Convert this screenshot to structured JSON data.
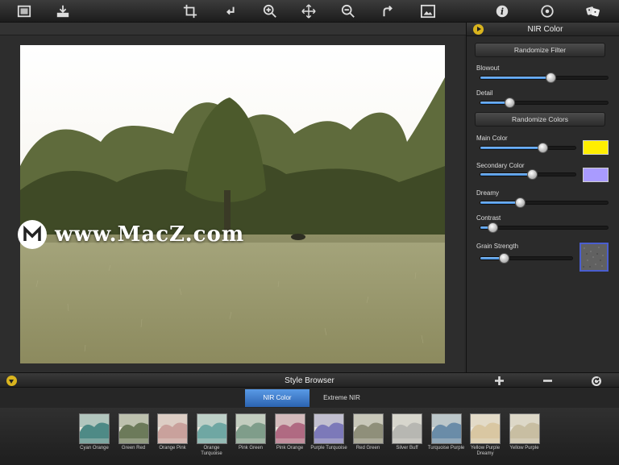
{
  "toolbar": {
    "icons": [
      "photo-icon",
      "save-icon",
      "crop-icon",
      "rotate-left-icon",
      "zoom-in-icon",
      "move-icon",
      "zoom-out-icon",
      "redo-icon",
      "fit-image-icon",
      "info-icon",
      "settings-icon",
      "dice-icon"
    ]
  },
  "watermark": {
    "text": "www.MacZ.com"
  },
  "panel": {
    "title": "NIR Color",
    "randomize_filter_label": "Randomize Filter",
    "randomize_colors_label": "Randomize Colors",
    "sliders": [
      {
        "label": "Blowout",
        "value": 0.55
      },
      {
        "label": "Detail",
        "value": 0.23
      },
      {
        "label": "Main Color",
        "value": 0.65
      },
      {
        "label": "Secondary Color",
        "value": 0.54
      },
      {
        "label": "Dreamy",
        "value": 0.31
      },
      {
        "label": "Contrast",
        "value": 0.1
      },
      {
        "label": "Grain Strength",
        "value": 0.26
      }
    ],
    "main_color": "#ffee00",
    "secondary_color": "#a99bff"
  },
  "style_browser": {
    "title": "Style Browser",
    "tabs": [
      "NIR Color",
      "Extreme NIR"
    ],
    "thumbnails": [
      {
        "label": "Cyan Orange",
        "color": "#4e8a86"
      },
      {
        "label": "Green Red",
        "color": "#6c7a5a"
      },
      {
        "label": "Orange Pink",
        "color": "#c9a19c"
      },
      {
        "label": "Orange Turquoise",
        "color": "#6fa7a3"
      },
      {
        "label": "Pink Green",
        "color": "#7f9d8a"
      },
      {
        "label": "Pink Orange",
        "color": "#b06a82"
      },
      {
        "label": "Purple Turquoise",
        "color": "#7c79b9"
      },
      {
        "label": "Red Green",
        "color": "#8f8f7a"
      },
      {
        "label": "Silver Buff",
        "color": "#b7b7b2"
      },
      {
        "label": "Turquoise Purple",
        "color": "#6a8ca8"
      },
      {
        "label": "Yellow Purple Dreamy",
        "color": "#d9c7a2"
      },
      {
        "label": "Yellow Purple",
        "color": "#c8bea2"
      }
    ]
  }
}
